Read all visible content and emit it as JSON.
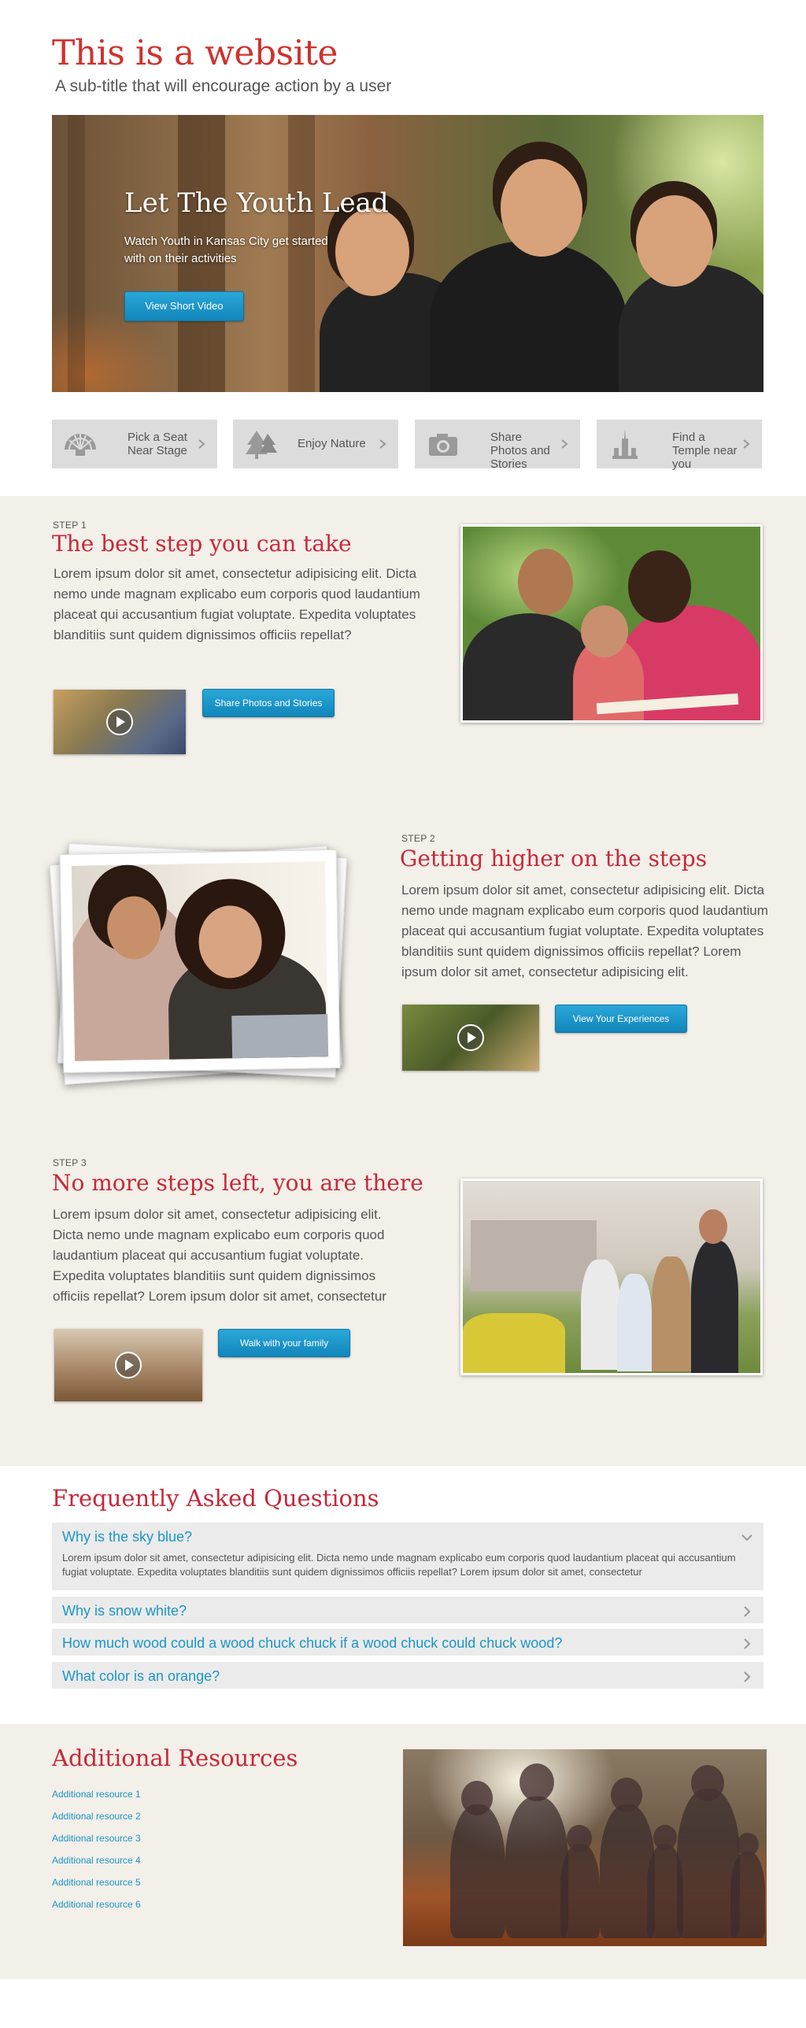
{
  "header": {
    "title": "This is a website",
    "subtitle": "A sub-title that will encourage action by a user"
  },
  "hero": {
    "title": "Let The Youth Lead",
    "description": "Watch Youth in Kansas City get started with on their activities",
    "button_label": "View Short Video"
  },
  "features": [
    {
      "label": "Pick a Seat Near Stage",
      "icon": "seat-fan-icon"
    },
    {
      "label": "Enjoy Nature",
      "icon": "tree-icon"
    },
    {
      "label": "Share Photos and Stories",
      "icon": "camera-icon"
    },
    {
      "label": "Find a Temple near you",
      "icon": "temple-icon"
    }
  ],
  "steps": [
    {
      "label": "STEP 1",
      "title": "The best step you can take",
      "body": "Lorem ipsum dolor sit amet, consectetur adipisicing elit. Dicta nemo unde magnam explicabo eum corporis quod laudantium placeat qui accusantium fugiat voluptate. Expedita voluptates blanditiis sunt quidem dignissimos officiis repellat?",
      "button_label": "Share Photos and Stories"
    },
    {
      "label": "STEP 2",
      "title": "Getting higher on the steps",
      "body": "Lorem ipsum dolor sit amet, consectetur adipisicing elit. Dicta nemo unde magnam explicabo eum corporis quod laudantium placeat qui accusantium fugiat voluptate. Expedita voluptates blanditiis sunt quidem dignissimos officiis repellat? Lorem ipsum dolor sit amet, consectetur adipisicing elit.",
      "button_label": "View Your Experiences"
    },
    {
      "label": "STEP 3",
      "title": "No more steps left, you are there",
      "body": "Lorem ipsum dolor sit amet, consectetur adipisicing elit. Dicta nemo unde magnam explicabo eum corporis quod laudantium placeat qui accusantium fugiat voluptate. Expedita voluptates blanditiis sunt quidem dignissimos officiis repellat? Lorem ipsum dolor sit amet, consectetur",
      "button_label": "Walk with your family"
    }
  ],
  "faq": {
    "title": "Frequently Asked Questions",
    "items": [
      {
        "question": "Why is the sky blue?",
        "answer": "Lorem ipsum dolor sit amet, consectetur adipisicing elit. Dicta nemo unde magnam explicabo eum corporis quod laudantium placeat qui accusantium fugiat voluptate. Expedita voluptates blanditiis sunt quidem dignissimos officiis repellat? Lorem ipsum dolor sit amet, consectetur",
        "expanded": true
      },
      {
        "question": "Why is snow white?",
        "expanded": false
      },
      {
        "question": "How much wood could a wood chuck chuck if a wood chuck could chuck wood?",
        "expanded": false
      },
      {
        "question": "What color is an orange?",
        "expanded": false
      }
    ]
  },
  "resources": {
    "title": "Additional Resources",
    "links": [
      "Additional resource 1",
      "Additional resource 2",
      "Additional resource 3",
      "Additional resource 4",
      "Additional resource 5",
      "Additional resource 6"
    ]
  },
  "colors": {
    "accent_red": "#c8283a",
    "link_blue": "#1b96c7",
    "button_blue": "#1b96c7",
    "section_beige": "#f3efe9",
    "tile_gray": "#dcdcdc"
  }
}
